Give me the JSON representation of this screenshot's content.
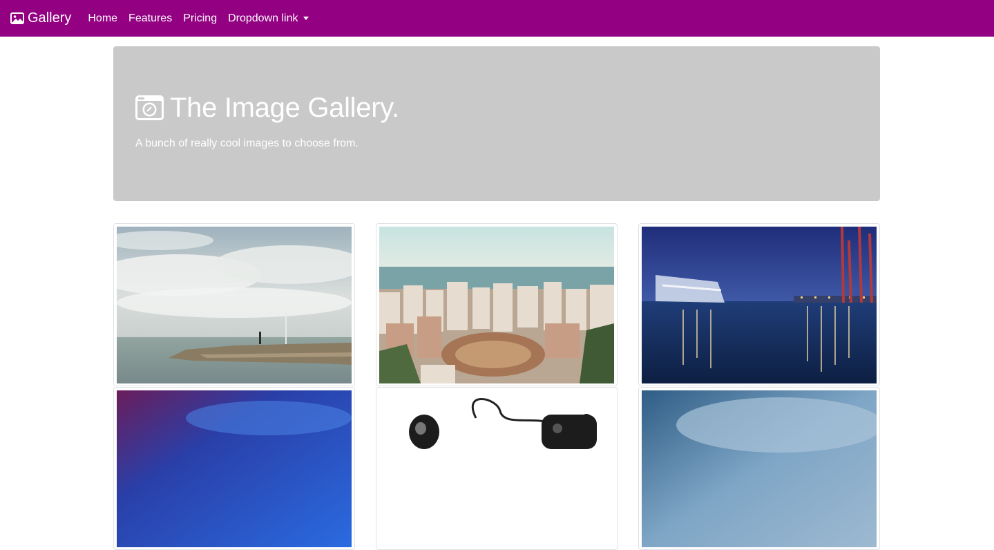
{
  "navbar": {
    "brand": "Gallery",
    "links": [
      "Home",
      "Features",
      "Pricing",
      "Dropdown link"
    ],
    "bg_color": "#930082"
  },
  "jumbotron": {
    "icon": "camera-icon",
    "title": "The Image Gallery.",
    "subtitle": "A bunch of really cool images to choose from."
  },
  "gallery": {
    "items": [
      {
        "subject": "pier-seascape-image"
      },
      {
        "subject": "city-bullring-image"
      },
      {
        "subject": "harbor-night-image"
      },
      {
        "subject": "blue-sky-image"
      },
      {
        "subject": "telephone-image"
      },
      {
        "subject": "blue-mist-image"
      }
    ]
  }
}
